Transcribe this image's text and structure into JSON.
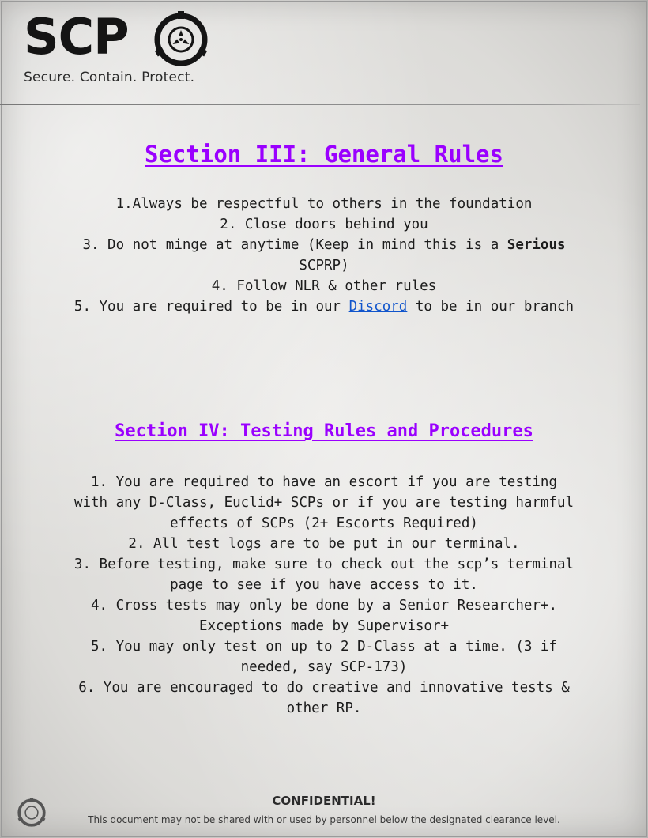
{
  "header": {
    "logo_text": "SCP",
    "logo_icon": "scp-emblem-icon",
    "tagline": "Secure. Contain. Protect."
  },
  "section3": {
    "title": "Section III: General Rules",
    "rules": {
      "r1": "1.Always be respectful to others in the foundation",
      "r2": "2. Close doors behind you",
      "r3_before": "3. Do not minge at anytime (Keep in mind this is a ",
      "r3_bold": "Serious",
      "r3_after": " SCPRP)",
      "r4": "4. Follow NLR & other rules",
      "r5_before": "5. You are required to be in our ",
      "r5_link": "Discord",
      "r5_after": " to be in our branch"
    }
  },
  "section4": {
    "title": "Section IV: Testing Rules and Procedures",
    "rules": [
      "1. You are required to have an escort if you are testing with any D-Class, Euclid+ SCPs or if you are testing harmful effects of SCPs (2+ Escorts Required)",
      "2. All test logs are to be put in our terminal.",
      "3. Before testing, make sure to check out the scp’s terminal page to see if you have access to it.",
      "4. Cross tests may only be done by a Senior Researcher+. Exceptions made by Supervisor+",
      "5. You may only test on up to 2 D-Class at a time. (3 if needed, say SCP-173)",
      "6. You are encouraged to do creative and innovative tests & other RP."
    ]
  },
  "footer": {
    "icon": "scp-emblem-icon",
    "confidential": "CONFIDENTIAL!",
    "disclaimer": "This document may not be shared with or used by personnel below the designated clearance level."
  },
  "colors": {
    "section_title": "#9a00ff",
    "link": "#1155cc",
    "text": "#1c1c1c"
  }
}
